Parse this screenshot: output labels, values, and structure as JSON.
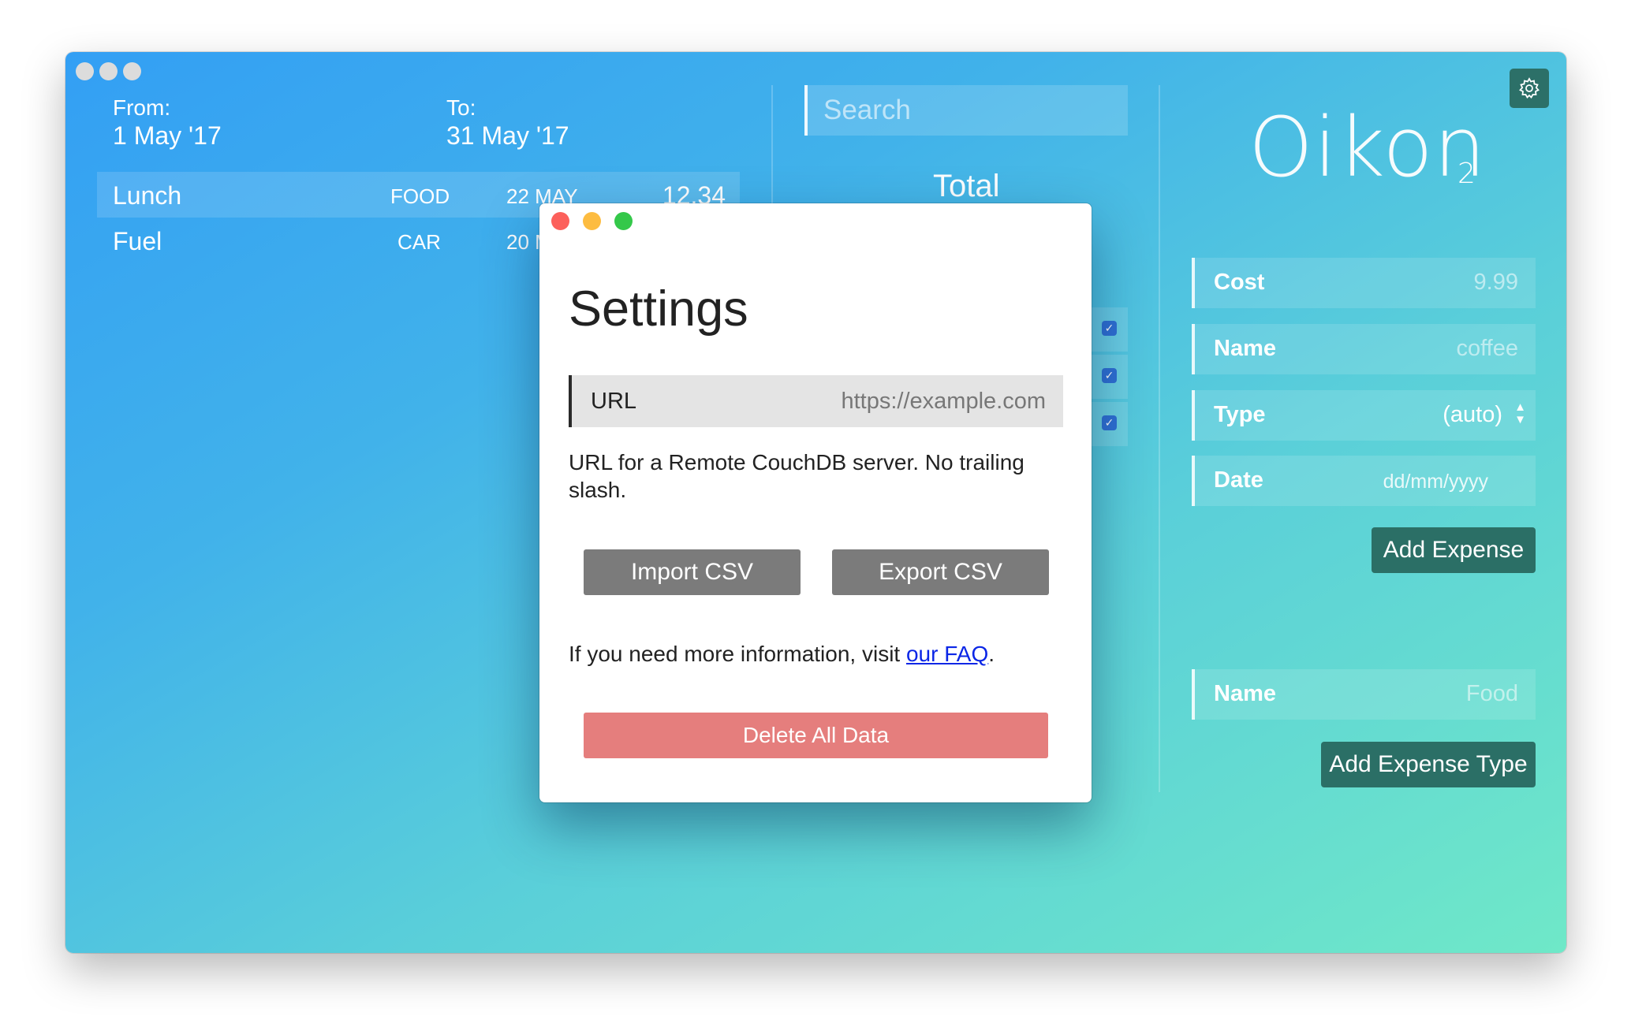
{
  "date_range": {
    "from_label": "From:",
    "from_value": "1 May '17",
    "to_label": "To:",
    "to_value": "31 May '17"
  },
  "expenses": [
    {
      "name": "Lunch",
      "type": "FOOD",
      "date": "22 MAY",
      "amount": "12.34"
    },
    {
      "name": "Fuel",
      "type": "CAR",
      "date": "20 MAY",
      "amount": ""
    }
  ],
  "search": {
    "placeholder": "Search"
  },
  "summary": {
    "total_label": "Total"
  },
  "app": {
    "name": "Oikon",
    "name_subscript": "2"
  },
  "expense_form": {
    "cost_label": "Cost",
    "cost_placeholder": "9.99",
    "name_label": "Name",
    "name_placeholder": "coffee",
    "type_label": "Type",
    "type_value": "(auto)",
    "date_label": "Date",
    "date_placeholder": "dd/mm/yyyy",
    "submit_label": "Add Expense"
  },
  "type_form": {
    "name_label": "Name",
    "name_placeholder": "Food",
    "submit_label": "Add Expense Type"
  },
  "settings_dialog": {
    "title": "Settings",
    "url_label": "URL",
    "url_placeholder": "https://example.com",
    "url_help": "URL for a Remote CouchDB server. No trailing slash.",
    "import_label": "Import CSV",
    "export_label": "Export CSV",
    "faq_prefix": "If you need more information, visit ",
    "faq_link": "our FAQ",
    "faq_suffix": ".",
    "delete_label": "Delete All Data"
  },
  "colors": {
    "gradient_start": "#339ff4",
    "gradient_end": "#6fe8c8",
    "button_dark_teal": "#2b6f66",
    "button_gray": "#7b7b7b",
    "button_delete": "#e57e7d",
    "link": "#0b26e6",
    "close": "#fc605b",
    "minimize": "#fdbc40",
    "zoom": "#34c84a"
  }
}
